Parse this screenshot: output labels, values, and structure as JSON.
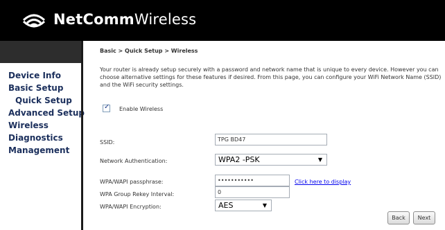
{
  "header": {
    "brand_bold": "NetComm",
    "brand_regular": "Wireless",
    "logo_icon": "wifi-icon"
  },
  "sidebar": {
    "items": [
      {
        "label": "Device Info"
      },
      {
        "label": "Basic Setup"
      },
      {
        "label": "Quick Setup"
      },
      {
        "label": "Advanced Setup"
      },
      {
        "label": "Wireless"
      },
      {
        "label": "Diagnostics"
      },
      {
        "label": "Management"
      }
    ]
  },
  "main": {
    "breadcrumb": "Basic > Quick Setup > Wireless",
    "intro": "Your router is already setup securely with a password and network name that is unique to every device. However you can choose alternative settings for these features if desired. From this page, you can configure your WiFi Network Name (SSID) and the WiFi security settings.",
    "enable_wireless": {
      "label": "Enable Wireless",
      "checked": true
    },
    "ssid": {
      "label": "SSID:",
      "value": "TPG BD47"
    },
    "network_auth": {
      "label": "Network Authentication:",
      "value": "WPA2 -PSK"
    },
    "passphrase": {
      "label": "WPA/WAPI passphrase:",
      "value": "•••••••••••",
      "link": "Click here to display"
    },
    "rekey": {
      "label": "WPA Group Rekey Interval:",
      "value": "0"
    },
    "encryption": {
      "label": "WPA/WAPI Encryption:",
      "value": "AES"
    },
    "buttons": {
      "back": "Back",
      "next": "Next"
    }
  },
  "colors": {
    "header_bg": "#000000",
    "nav_text": "#1b2f5c",
    "link": "#0000ee"
  }
}
